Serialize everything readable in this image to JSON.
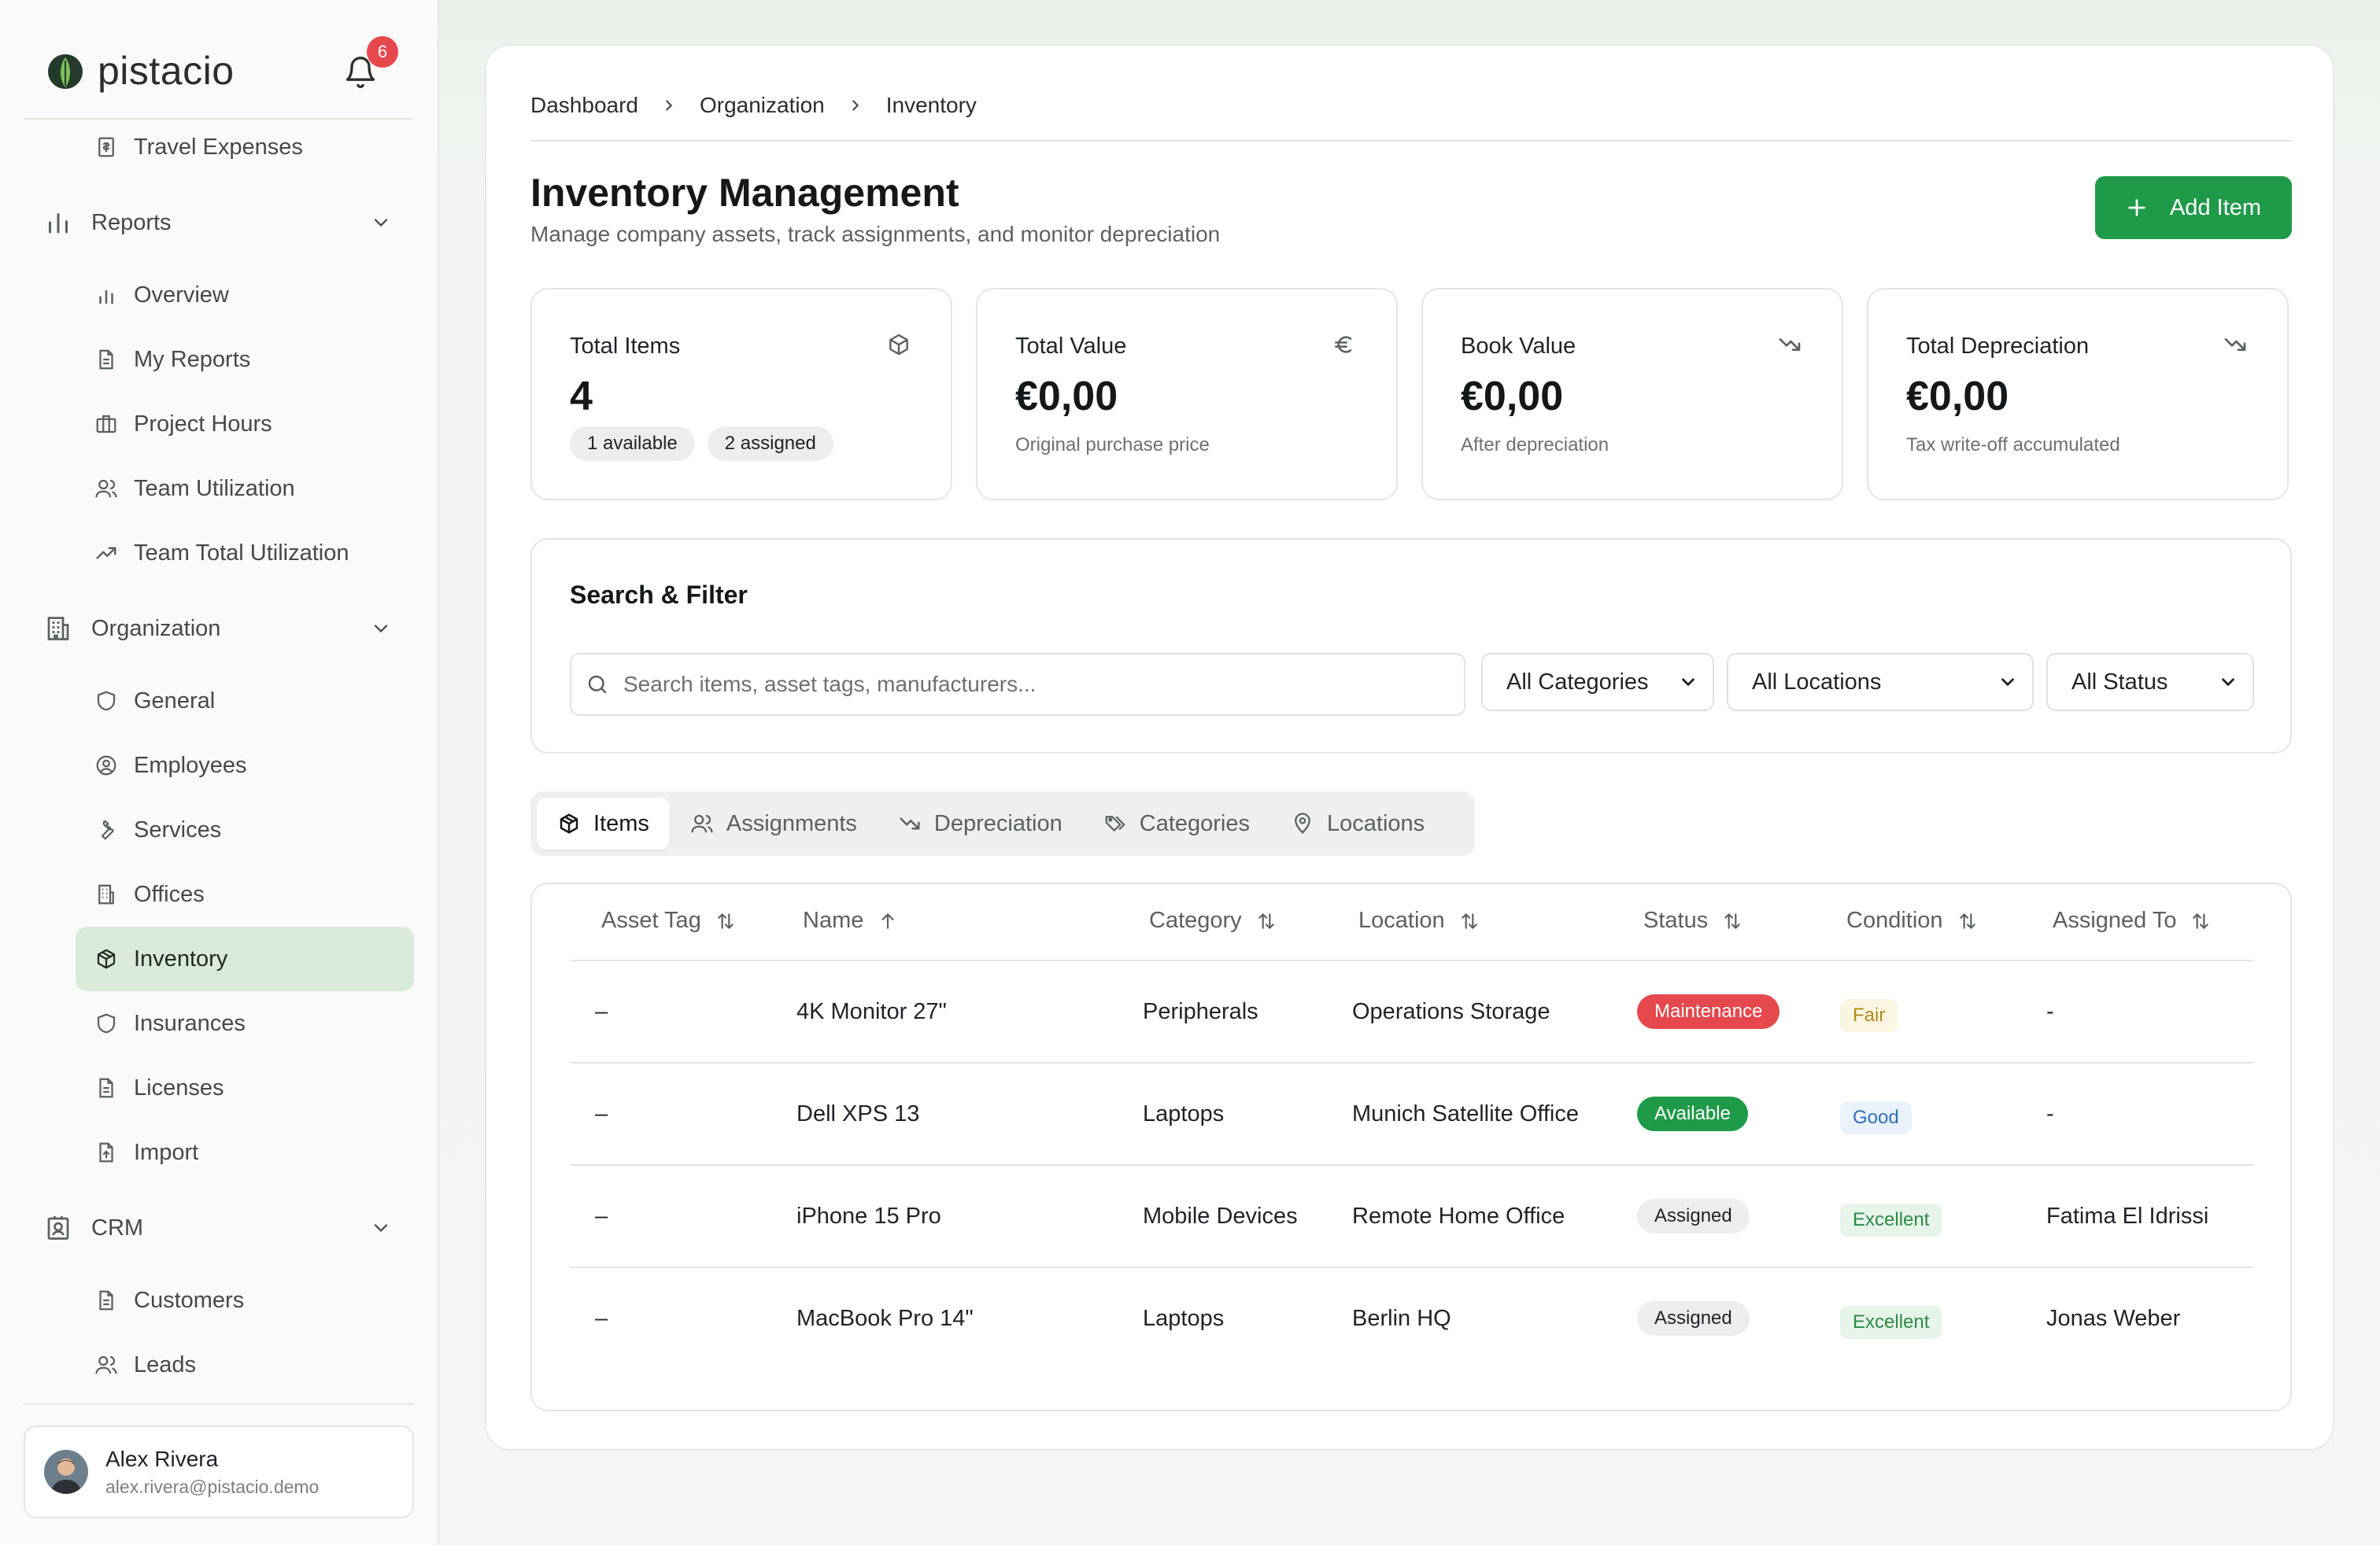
{
  "app": {
    "brand": "pistacio",
    "notifications_count": "6"
  },
  "sidebar": {
    "top_item": {
      "label": "Travel Expenses",
      "icon": "receipt-icon"
    },
    "groups": [
      {
        "label": "Reports",
        "icon": "bar-chart-icon",
        "expanded": true,
        "items": [
          {
            "label": "Overview",
            "icon": "bar-chart-icon"
          },
          {
            "label": "My Reports",
            "icon": "document-icon"
          },
          {
            "label": "Project Hours",
            "icon": "briefcase-icon"
          },
          {
            "label": "Team Utilization",
            "icon": "users-icon"
          },
          {
            "label": "Team Total Utilization",
            "icon": "trending-up-icon"
          }
        ]
      },
      {
        "label": "Organization",
        "icon": "building-icon",
        "expanded": true,
        "items": [
          {
            "label": "General",
            "icon": "shield-icon"
          },
          {
            "label": "Employees",
            "icon": "user-circle-icon"
          },
          {
            "label": "Services",
            "icon": "wrench-icon"
          },
          {
            "label": "Offices",
            "icon": "office-building-icon"
          },
          {
            "label": "Inventory",
            "icon": "package-icon",
            "active": true
          },
          {
            "label": "Insurances",
            "icon": "shield-icon"
          },
          {
            "label": "Licenses",
            "icon": "document-icon"
          },
          {
            "label": "Import",
            "icon": "file-upload-icon"
          }
        ]
      },
      {
        "label": "CRM",
        "icon": "contact-icon",
        "expanded": true,
        "items": [
          {
            "label": "Customers",
            "icon": "document-icon"
          },
          {
            "label": "Leads",
            "icon": "users-icon"
          }
        ]
      }
    ],
    "user": {
      "name": "Alex Rivera",
      "email": "alex.rivera@pistacio.demo"
    }
  },
  "breadcrumb": [
    "Dashboard",
    "Organization",
    "Inventory"
  ],
  "page": {
    "title": "Inventory Management",
    "subtitle": "Manage company assets, track assignments, and monitor depreciation",
    "add_button": "Add Item"
  },
  "stats": [
    {
      "label": "Total Items",
      "value": "4",
      "icon": "package-icon",
      "pills": [
        "1 available",
        "2 assigned"
      ]
    },
    {
      "label": "Total Value",
      "value": "€0,00",
      "icon": "euro-icon",
      "note": "Original purchase price"
    },
    {
      "label": "Book Value",
      "value": "€0,00",
      "icon": "trending-down-icon",
      "note": "After depreciation"
    },
    {
      "label": "Total Depreciation",
      "value": "€0,00",
      "icon": "trending-down-icon",
      "note": "Tax write-off accumulated"
    }
  ],
  "filter": {
    "title": "Search & Filter",
    "search_placeholder": "Search items, asset tags, manufacturers...",
    "category": "All Categories",
    "location": "All Locations",
    "status": "All Status"
  },
  "tabs": [
    {
      "label": "Items",
      "icon": "package-icon",
      "active": true
    },
    {
      "label": "Assignments",
      "icon": "users-icon"
    },
    {
      "label": "Depreciation",
      "icon": "trending-down-icon"
    },
    {
      "label": "Categories",
      "icon": "tags-icon"
    },
    {
      "label": "Locations",
      "icon": "map-pin-icon"
    }
  ],
  "table": {
    "columns": [
      "Asset Tag",
      "Name",
      "Category",
      "Location",
      "Status",
      "Condition",
      "Assigned To"
    ],
    "sorted_column": "Name",
    "rows": [
      {
        "asset_tag": "–",
        "name": "4K Monitor 27\"",
        "category": "Peripherals",
        "location": "Operations Storage",
        "status": "Maintenance",
        "condition": "Fair",
        "assigned_to": "-"
      },
      {
        "asset_tag": "–",
        "name": "Dell XPS 13",
        "category": "Laptops",
        "location": "Munich Satellite Office",
        "status": "Available",
        "condition": "Good",
        "assigned_to": "-"
      },
      {
        "asset_tag": "–",
        "name": "iPhone 15 Pro",
        "category": "Mobile Devices",
        "location": "Remote Home Office",
        "status": "Assigned",
        "condition": "Excellent",
        "assigned_to": "Fatima El Idrissi"
      },
      {
        "asset_tag": "–",
        "name": "MacBook Pro 14\"",
        "category": "Laptops",
        "location": "Berlin HQ",
        "status": "Assigned",
        "condition": "Excellent",
        "assigned_to": "Jonas Weber"
      }
    ]
  },
  "colors": {
    "accent_green": "#1f9a48",
    "active_nav_bg": "#d9ead9",
    "status_maintenance": "#e5484d",
    "status_available": "#1f9a48",
    "condition_fair": "#b08a18",
    "condition_good": "#2f6fb7",
    "condition_excellent": "#2d8a46"
  }
}
